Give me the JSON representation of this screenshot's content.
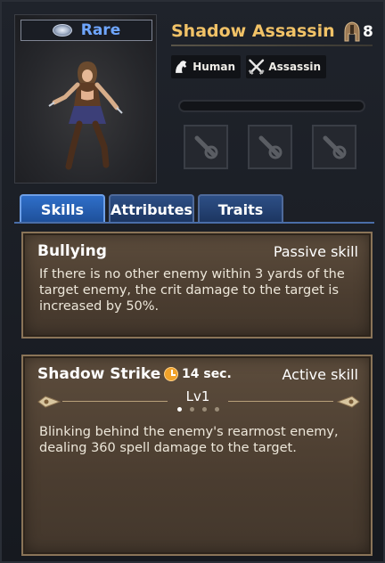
{
  "hero": {
    "rarity": "Rare",
    "name": "Shadow Assassin",
    "level": "8",
    "race": "Human",
    "class": "Assassin",
    "exp_progress": 0
  },
  "tabs": [
    {
      "label": "Skills",
      "active": true
    },
    {
      "label": "Attributes",
      "active": false
    },
    {
      "label": "Traits",
      "active": false
    }
  ],
  "skills": [
    {
      "name": "Bullying",
      "type": "Passive skill",
      "description": "If there is no other enemy within 3 yards of the target enemy, the crit damage to the target is increased by 50%."
    },
    {
      "name": "Shadow Strike",
      "cooldown": "14 sec.",
      "type": "Active skill",
      "level": "Lv1",
      "level_dots": 4,
      "current_dot": 1,
      "description": "Blinking behind the enemy's rearmost enemy, dealing 360 spell damage to the target."
    }
  ],
  "colors": {
    "rarity": "#6fa6ff",
    "hero_name": "#f1c267",
    "tab_active": "#2f6fc9"
  }
}
